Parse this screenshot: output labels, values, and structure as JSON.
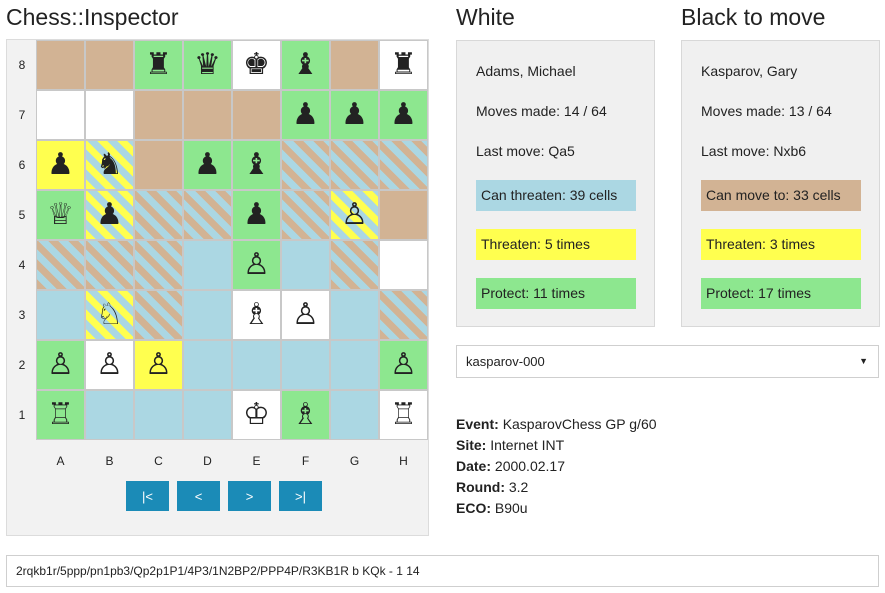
{
  "app": {
    "title": "Chess::Inspector"
  },
  "board": {
    "ranks": [
      "8",
      "7",
      "6",
      "5",
      "4",
      "3",
      "2",
      "1"
    ],
    "files": [
      "A",
      "B",
      "C",
      "D",
      "E",
      "F",
      "G",
      "H"
    ],
    "rows": [
      [
        {
          "color": "tan",
          "piece": ""
        },
        {
          "color": "tan",
          "piece": ""
        },
        {
          "color": "green",
          "piece": "♜"
        },
        {
          "color": "green",
          "piece": "♛"
        },
        {
          "color": "white",
          "piece": "♚"
        },
        {
          "color": "green",
          "piece": "♝"
        },
        {
          "color": "tan",
          "piece": ""
        },
        {
          "color": "white",
          "piece": "♜"
        }
      ],
      [
        {
          "color": "white",
          "piece": ""
        },
        {
          "color": "white",
          "piece": ""
        },
        {
          "color": "tan",
          "piece": ""
        },
        {
          "color": "tan",
          "piece": ""
        },
        {
          "color": "tan",
          "piece": ""
        },
        {
          "color": "green",
          "piece": "♟"
        },
        {
          "color": "green",
          "piece": "♟"
        },
        {
          "color": "green",
          "piece": "♟"
        }
      ],
      [
        {
          "color": "yellow",
          "piece": "♟"
        },
        {
          "color": "stripe-yellow",
          "piece": "♞"
        },
        {
          "color": "tan",
          "piece": ""
        },
        {
          "color": "green",
          "piece": "♟"
        },
        {
          "color": "green",
          "piece": "♝"
        },
        {
          "color": "stripe",
          "piece": ""
        },
        {
          "color": "stripe",
          "piece": ""
        },
        {
          "color": "stripe",
          "piece": ""
        }
      ],
      [
        {
          "color": "green",
          "piece": "♕"
        },
        {
          "color": "stripe-yellow",
          "piece": "♟"
        },
        {
          "color": "stripe",
          "piece": ""
        },
        {
          "color": "stripe",
          "piece": ""
        },
        {
          "color": "green",
          "piece": "♟"
        },
        {
          "color": "stripe",
          "piece": ""
        },
        {
          "color": "stripe-yellow",
          "piece": "♙"
        },
        {
          "color": "tan",
          "piece": ""
        }
      ],
      [
        {
          "color": "stripe",
          "piece": ""
        },
        {
          "color": "stripe",
          "piece": ""
        },
        {
          "color": "stripe",
          "piece": ""
        },
        {
          "color": "blue",
          "piece": ""
        },
        {
          "color": "green",
          "piece": "♙"
        },
        {
          "color": "blue",
          "piece": ""
        },
        {
          "color": "stripe",
          "piece": ""
        },
        {
          "color": "white",
          "piece": ""
        }
      ],
      [
        {
          "color": "blue",
          "piece": ""
        },
        {
          "color": "stripe-yellow",
          "piece": "♘"
        },
        {
          "color": "stripe",
          "piece": ""
        },
        {
          "color": "blue",
          "piece": ""
        },
        {
          "color": "white",
          "piece": "♗"
        },
        {
          "color": "white",
          "piece": "♙"
        },
        {
          "color": "blue",
          "piece": ""
        },
        {
          "color": "stripe",
          "piece": ""
        }
      ],
      [
        {
          "color": "green",
          "piece": "♙"
        },
        {
          "color": "white",
          "piece": "♙"
        },
        {
          "color": "yellow",
          "piece": "♙"
        },
        {
          "color": "blue",
          "piece": ""
        },
        {
          "color": "blue",
          "piece": ""
        },
        {
          "color": "blue",
          "piece": ""
        },
        {
          "color": "blue",
          "piece": ""
        },
        {
          "color": "green",
          "piece": "♙"
        }
      ],
      [
        {
          "color": "green",
          "piece": "♖"
        },
        {
          "color": "blue",
          "piece": ""
        },
        {
          "color": "blue",
          "piece": ""
        },
        {
          "color": "blue",
          "piece": ""
        },
        {
          "color": "white",
          "piece": "♔"
        },
        {
          "color": "green",
          "piece": "♗"
        },
        {
          "color": "blue",
          "piece": ""
        },
        {
          "color": "white",
          "piece": "♖"
        }
      ]
    ]
  },
  "navigation": {
    "first_label": "|<",
    "prev_label": "<",
    "next_label": ">",
    "last_label": ">|"
  },
  "white": {
    "heading": "White",
    "player": "Adams, Michael",
    "moves": "Moves made: 14 / 64",
    "last_move": "Last move: Qa5",
    "reach": "Can threaten: 39 cells",
    "threaten": "Threaten: 5 times",
    "protect": "Protect: 11 times"
  },
  "black": {
    "heading": "Black to move",
    "player": "Kasparov, Gary",
    "moves": "Moves made: 13 / 64",
    "last_move": "Last move: Nxb6",
    "reach": "Can move to: 33 cells",
    "threaten": "Threaten: 3 times",
    "protect": "Protect: 17 times"
  },
  "game_select": {
    "value": "kasparov-000"
  },
  "meta": {
    "event_label": "Event:",
    "event": "KasparovChess GP g/60",
    "site_label": "Site:",
    "site": "Internet INT",
    "date_label": "Date:",
    "date": "2000.02.17",
    "round_label": "Round:",
    "round": "3.2",
    "eco_label": "ECO:",
    "eco": "B90u"
  },
  "fen": "2rqkb1r/5ppp/pn1pb3/Qp2p1P1/4P3/1N2BP2/PPP4P/R3KB1R b KQk - 1 14",
  "colors": {
    "tan": "#d2b394",
    "green": "#8de78f",
    "blue": "#abd7e3",
    "yellow": "#ffff4f",
    "button": "#1b8bb7"
  }
}
